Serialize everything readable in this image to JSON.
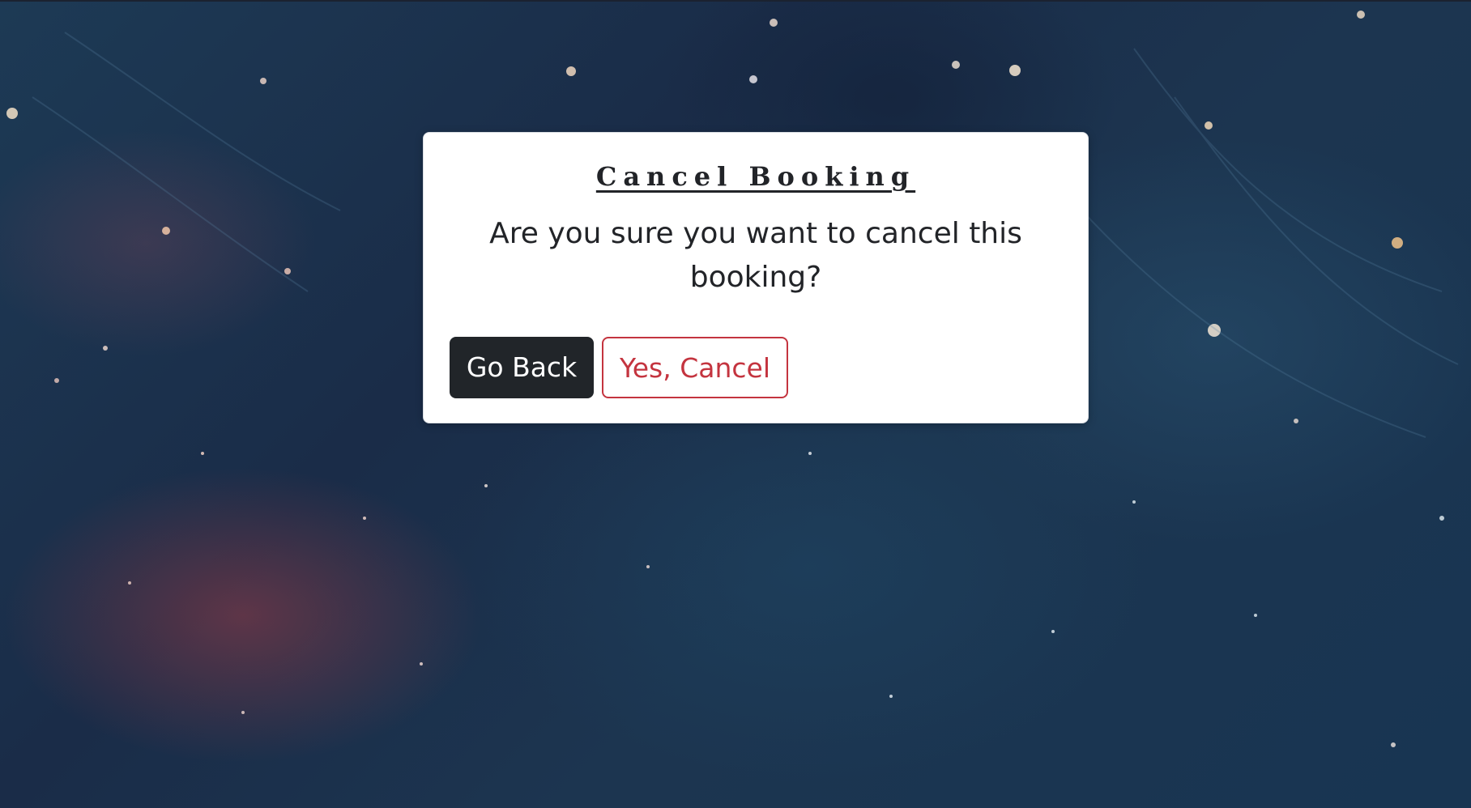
{
  "dialog": {
    "title": "Cancel Booking",
    "message": "Are you sure you want to cancel this booking?",
    "go_back_label": "Go Back",
    "confirm_label": "Yes, Cancel"
  },
  "colors": {
    "primary_dark": "#212529",
    "danger": "#c4343f",
    "modal_background": "#ffffff",
    "page_background": "#1a2c48"
  }
}
